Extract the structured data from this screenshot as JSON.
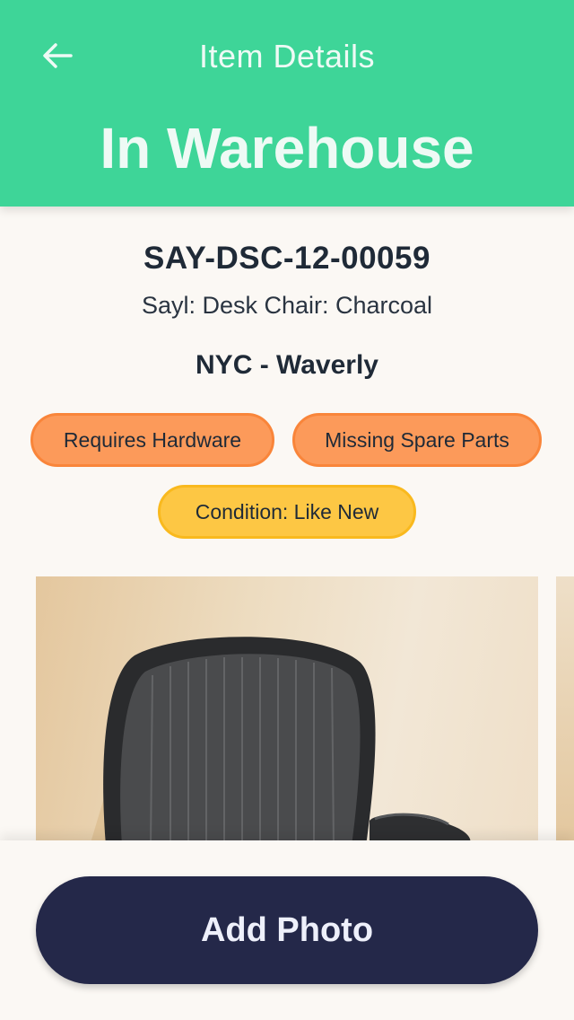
{
  "header": {
    "nav_title": "Item Details",
    "status_title": "In Warehouse",
    "back_icon": "arrow-left-icon",
    "color": "#3ed598"
  },
  "item": {
    "sku": "SAY-DSC-12-00059",
    "description": "Sayl: Desk Chair: Charcoal",
    "location": "NYC - Waverly"
  },
  "tags": [
    {
      "label": "Requires Hardware",
      "color": "#fc9a5a"
    },
    {
      "label": "Missing Spare Parts",
      "color": "#fc9a5a"
    },
    {
      "label": "Condition: Like New",
      "color": "#fdc744"
    }
  ],
  "photos": {
    "count_visible": 2
  },
  "actions": {
    "add_photo_label": "Add Photo",
    "button_color": "#242849"
  }
}
